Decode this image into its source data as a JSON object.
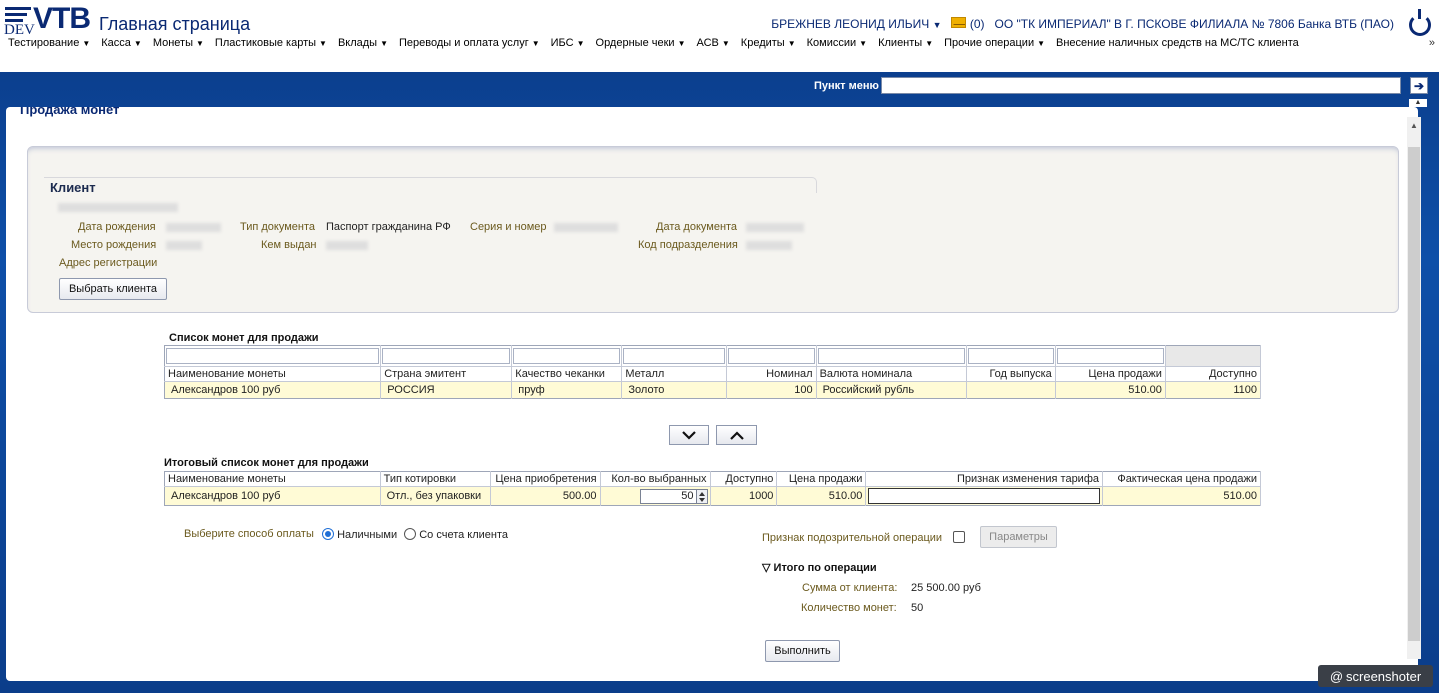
{
  "header": {
    "logo_dev": "DEV",
    "logo_vtb": "VTB",
    "page_title": "Главная страница",
    "user_name": "БРЕЖНЕВ ЛЕОНИД ИЛЬИЧ",
    "mail_count": "(0)",
    "organization": "ОО \"ТК ИМПЕРИАЛ\" В Г. ПСКОВЕ ФИЛИАЛА № 7806 Банка ВТБ (ПАО)"
  },
  "menu": [
    "Тестирование",
    "Касса",
    "Монеты",
    "Пластиковые карты",
    "Вклады",
    "Переводы и оплата услуг",
    "ИБС",
    "Ордерные чеки",
    "АСВ",
    "Кредиты",
    "Комиссии",
    "Клиенты",
    "Прочие операции",
    "Внесение наличных средств на МС/ТС клиента"
  ],
  "menu_more": "»",
  "search": {
    "label": "Пункт меню",
    "value": "",
    "go_icon": "arrow-right-icon"
  },
  "panel": {
    "title": "Продажа монет"
  },
  "client": {
    "title": "Клиент",
    "labels": {
      "birth_date": "Дата рождения",
      "birth_place": "Место рождения",
      "reg_address": "Адрес регистрации",
      "doc_type": "Тип документа",
      "issued_by": "Кем выдан",
      "series_number": "Серия и номер",
      "doc_date": "Дата документа",
      "subdivision_code": "Код подразделения"
    },
    "doc_type_value": "Паспорт гражданина РФ",
    "select_button": "Выбрать клиента"
  },
  "coins_list": {
    "title": "Список монет для продажи",
    "columns": [
      "Наименование монеты",
      "Страна эмитент",
      "Качество чеканки",
      "Металл",
      "Номинал",
      "Валюта номинала",
      "Год выпуска",
      "Цена продажи",
      "Доступно"
    ],
    "rows": [
      [
        "Александров 100 руб",
        "РОССИЯ",
        "пруф",
        "Золото",
        "100",
        "Российский рубль",
        "",
        "510.00",
        "1100"
      ]
    ]
  },
  "final_list": {
    "title": "Итоговый список монет для продажи",
    "columns": [
      "Наименование монеты",
      "Тип котировки",
      "Цена приобретения",
      "Кол-во выбранных",
      "Доступно",
      "Цена продажи",
      "Признак изменения тарифа",
      "Фактическая цена продажи"
    ],
    "rows": [
      [
        "Александров 100 руб",
        "Отл., без упаковки",
        "500.00",
        "50",
        "1000",
        "510.00",
        "",
        "510.00"
      ]
    ]
  },
  "payment": {
    "label": "Выберите способ оплаты",
    "options": [
      "Наличными",
      "Со счета клиента"
    ],
    "selected": "Наличными"
  },
  "suspicious": {
    "label": "Признак подозрительной операции",
    "checked": false,
    "params_button": "Параметры"
  },
  "totals": {
    "title": "Итого по операции",
    "sum_label": "Сумма от клиента:",
    "sum_value": "25 500.00 руб",
    "count_label": "Количество монет:",
    "count_value": "50"
  },
  "execute_button": "Выполнить",
  "watermark": "screenshoter"
}
